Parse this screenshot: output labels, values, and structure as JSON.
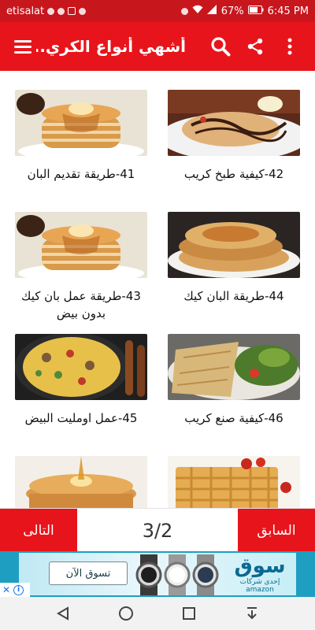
{
  "status_bar": {
    "carrier": "etisalat",
    "battery": "67%",
    "time": "6:45 PM"
  },
  "app_bar": {
    "title": "أشهي أنواع الكري...",
    "icons": [
      "menu-icon",
      "search-icon",
      "share-icon",
      "more-vert-icon"
    ]
  },
  "grid": {
    "items": [
      {
        "label": "42-كيفية طبخ كريب",
        "image": "crepe-chocolate"
      },
      {
        "label": "41-طريقة تقديم البان",
        "image": "pancake-stack"
      },
      {
        "label": "44-طريقة البان كيك",
        "image": "pancakes-plate"
      },
      {
        "label": "43-طريقة عمل بان كيك بدون بيض",
        "image": "pancake-stack"
      },
      {
        "label": "46-كيفية صنع كريب",
        "image": "crepe-salad"
      },
      {
        "label": "45-عمل اومليت البيض",
        "image": "omelette"
      },
      {
        "label": "",
        "image": "waffles"
      },
      {
        "label": "",
        "image": "pancake-syrup"
      }
    ]
  },
  "pager": {
    "next_label": "التالى",
    "prev_label": "السابق",
    "page": "3/2"
  },
  "ad": {
    "shop_label": "تسوق الآن",
    "brand": "سوق",
    "brand_sub": "إحدى شركات amazon"
  },
  "colors": {
    "primary": "#e8141b",
    "status_bar": "#c8161d"
  }
}
